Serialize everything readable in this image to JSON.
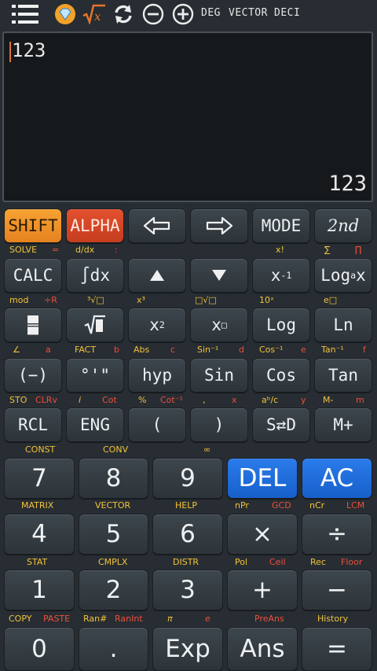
{
  "topbar": {
    "deg": "DEG",
    "vector": "VECTOR",
    "deci": "DECI"
  },
  "display": {
    "input": "123",
    "result": "123"
  },
  "keys": {
    "shift": "SHIFT",
    "alpha": "ALPHA",
    "mode": "MODE",
    "nd": "2nd",
    "calc": "CALC",
    "integral": "∫dx",
    "hyp": "hyp",
    "sin": "Sin",
    "cos": "Cos",
    "tan": "Tan",
    "rcl": "RCL",
    "eng": "ENG",
    "lparen": "(",
    "rparen": ")",
    "sd": "S⇄D",
    "mplus": "M+",
    "n7": "7",
    "n8": "8",
    "n9": "9",
    "del": "DEL",
    "ac": "AC",
    "n4": "4",
    "n5": "5",
    "n6": "6",
    "mul": "×",
    "div": "÷",
    "n1": "1",
    "n2": "2",
    "n3": "3",
    "plus": "+",
    "minus": "−",
    "n0": "0",
    "dot": ".",
    "exp": "Exp",
    "ans": "Ans",
    "eq": "="
  },
  "secondary": {
    "r1": [
      "SOLVE",
      "=",
      "d/dx",
      ":",
      "x!",
      "∑",
      "∏"
    ],
    "r2": [
      "mod",
      "÷R",
      "³√□",
      "x³",
      "□√□",
      "10ˣ",
      "e□"
    ],
    "r3": [
      "∠",
      "a",
      "FACT",
      "b",
      "Abs",
      "c",
      "Sin⁻¹",
      "d",
      "Cos⁻¹",
      "e",
      "Tan⁻¹",
      "f"
    ],
    "r4": [
      "STO",
      "CLRv",
      "i",
      "Cot",
      "%",
      "Cot⁻¹",
      ",",
      "x",
      "aᵇ/c",
      "y",
      "M-",
      "m"
    ],
    "r5": [
      "CONST",
      "CONV",
      "∞"
    ],
    "r6": [
      "MATRIX",
      "VECTOR",
      "HELP",
      "nPr",
      "GCD",
      "nCr",
      "LCM"
    ],
    "r7": [
      "STAT",
      "CMPLX",
      "DISTR",
      "Pol",
      "Ceil",
      "Rec",
      "Floor"
    ],
    "r8": [
      "COPY",
      "PASTE",
      "Ran#",
      "RanInt",
      "π",
      "e",
      "PreAns",
      "History"
    ]
  },
  "colors": {
    "shift": "#f29b2f",
    "alpha": "#d8462a",
    "blue": "#1f6fe0",
    "secondary_label": "#f4c33a",
    "alpha_label": "#ee4e3c"
  },
  "icons": [
    "menu-icon",
    "diamond-icon",
    "sqrt-x-icon",
    "refresh-icon",
    "minus-circle-icon",
    "plus-circle-icon",
    "arrow-left-icon",
    "arrow-right-icon",
    "arrow-up-icon",
    "arrow-down-icon",
    "fraction-icon",
    "sqrt-icon"
  ]
}
